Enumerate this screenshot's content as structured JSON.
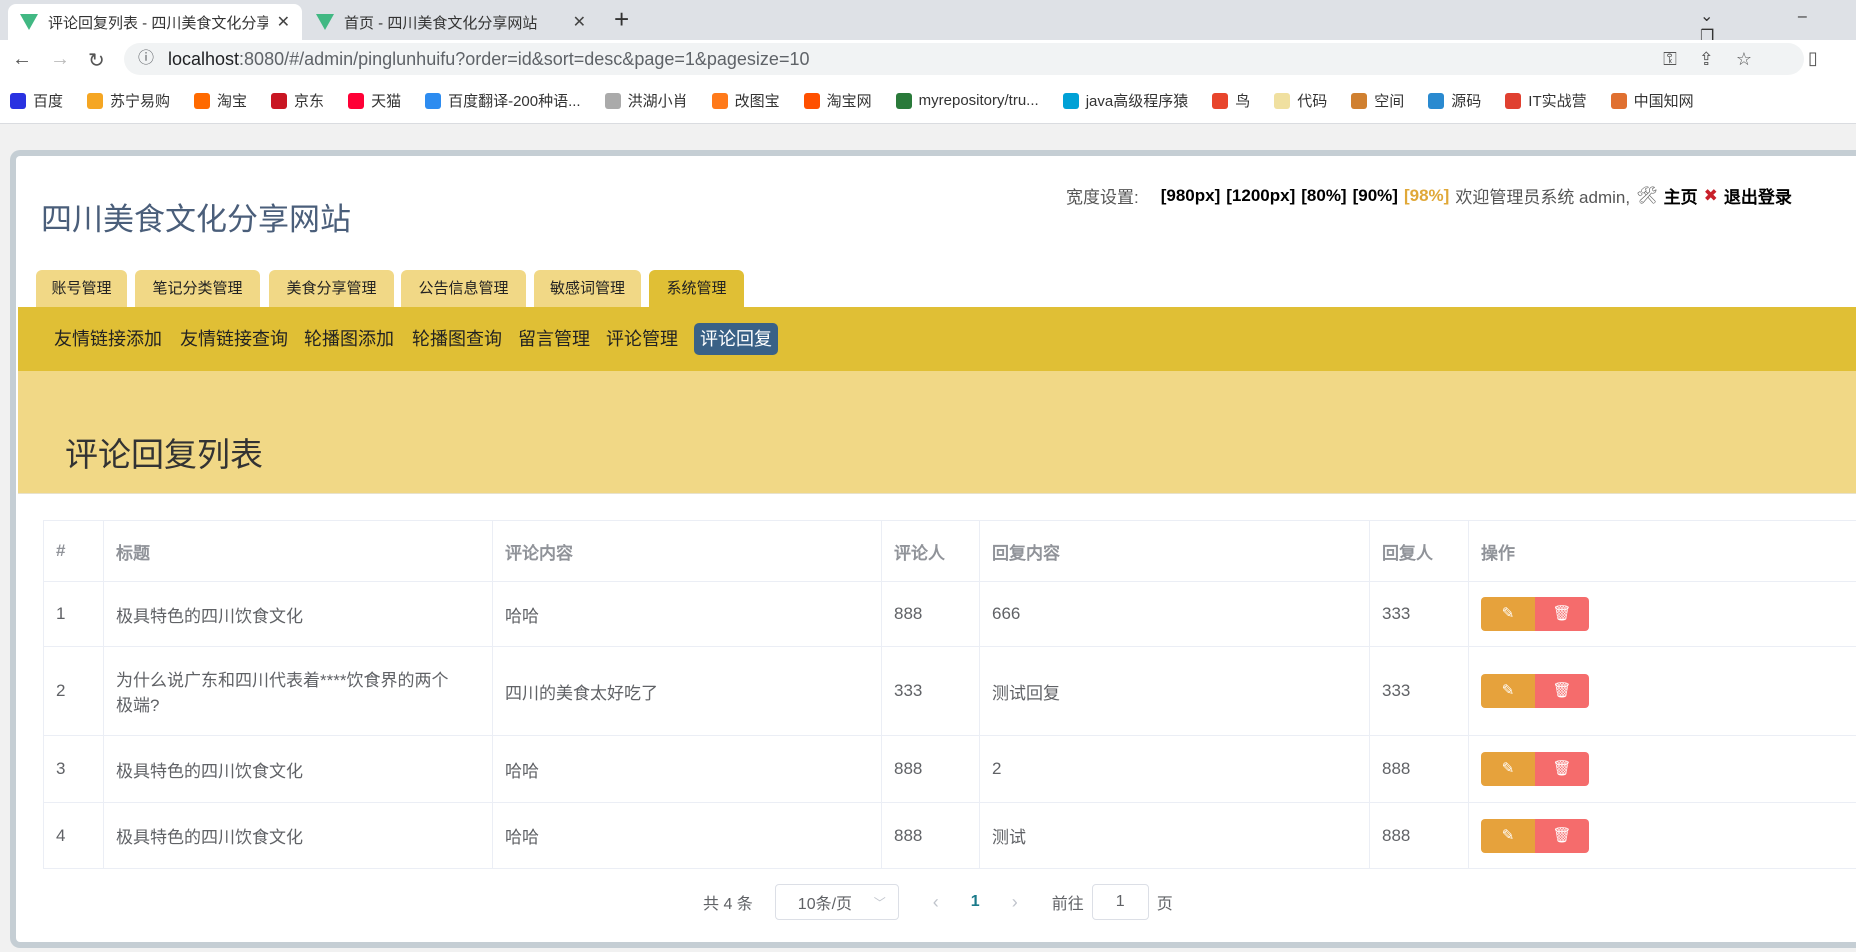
{
  "browser": {
    "tabs": [
      {
        "title": "评论回复列表 - 四川美食文化分享网站"
      },
      {
        "title": "首页 - 四川美食文化分享网站"
      }
    ],
    "url": {
      "host": "localhost",
      "rest": ":8080/#/admin/pinglunhuifu?order=id&sort=desc&page=1&pagesize=10"
    },
    "bookmarks": [
      {
        "label": "百度",
        "color": "#2932e1"
      },
      {
        "label": "苏宁易购",
        "color": "#f5a623"
      },
      {
        "label": "淘宝",
        "color": "#ff6a00"
      },
      {
        "label": "京东",
        "color": "#c91623"
      },
      {
        "label": "天猫",
        "color": "#ff0036"
      },
      {
        "label": "百度翻译-200种语...",
        "color": "#2d8cf0"
      },
      {
        "label": "洪湖小肖",
        "color": "#aaa"
      },
      {
        "label": "改图宝",
        "color": "#ff7a1a"
      },
      {
        "label": "淘宝网",
        "color": "#ff5000"
      },
      {
        "label": "myrepository/tru...",
        "color": "#2a7a3a"
      },
      {
        "label": "java高级程序猿",
        "color": "#00a1d6"
      },
      {
        "label": "鸟",
        "color": "#e8452c"
      },
      {
        "label": "代码",
        "color": "#f0e0a0"
      },
      {
        "label": "空间",
        "color": "#d08030"
      },
      {
        "label": "源码",
        "color": "#2a8ad0"
      },
      {
        "label": "IT实战营",
        "color": "#e04030"
      },
      {
        "label": "中国知网",
        "color": "#e07030"
      }
    ]
  },
  "header": {
    "site_title": "四川美食文化分享网站",
    "width_label": "宽度设置:",
    "widths": [
      "[980px]",
      "[1200px]",
      "[80%]",
      "[90%]"
    ],
    "current_width": "[98%]",
    "welcome": "欢迎管理员系统 admin,",
    "home": "主页",
    "logout": "退出登录"
  },
  "main_tabs": [
    "账号管理",
    "笔记分类管理",
    "美食分享管理",
    "公告信息管理",
    "敏感词管理",
    "系统管理"
  ],
  "sub_nav": [
    "友情链接添加",
    "友情链接查询",
    "轮播图添加",
    "轮播图查询",
    "留言管理",
    "评论管理",
    "评论回复"
  ],
  "page_title": "评论回复列表",
  "table": {
    "headers": [
      "#",
      "标题",
      "评论内容",
      "评论人",
      "回复内容",
      "回复人",
      "操作"
    ],
    "rows": [
      [
        "1",
        "极具特色的四川饮食文化",
        "哈哈",
        "888",
        "666",
        "333"
      ],
      [
        "2",
        "为什么说广东和四川代表着****饮食界的两个极端?",
        "四川的美食太好吃了",
        "333",
        "测试回复",
        "333"
      ],
      [
        "3",
        "极具特色的四川饮食文化",
        "哈哈",
        "888",
        "2",
        "888"
      ],
      [
        "4",
        "极具特色的四川饮食文化",
        "哈哈",
        "888",
        "测试",
        "888"
      ]
    ]
  },
  "pagination": {
    "total": "共 4 条",
    "page_size": "10条/页",
    "current": "1",
    "goto_label": "前往",
    "goto_value": "1",
    "page_suffix": "页"
  }
}
